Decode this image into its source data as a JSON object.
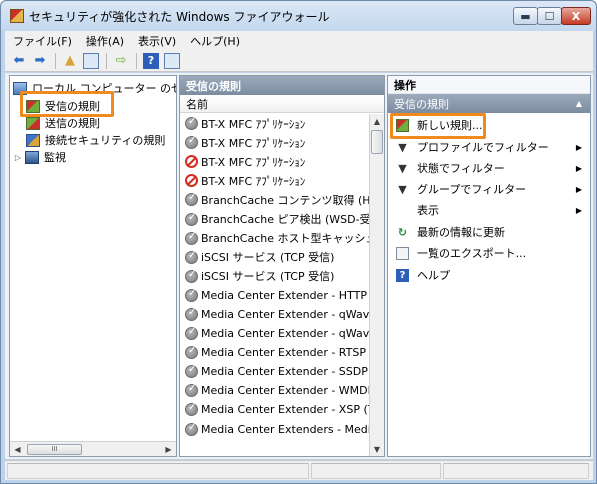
{
  "window": {
    "title": "セキュリティが強化された Windows ファイアウォール",
    "minimize": "▬",
    "maximize": "☐",
    "close": "X"
  },
  "menu": [
    "ファイル(F)",
    "操作(A)",
    "表示(V)",
    "ヘルプ(H)"
  ],
  "tree": {
    "root": "ローカル コンピューター のセ",
    "items": [
      "受信の規則",
      "送信の規則",
      "接続セキュリティの規則",
      "監視"
    ]
  },
  "middle": {
    "header": "受信の規則",
    "column": "名前",
    "rules": [
      {
        "name": "BT-X MFC ｱﾌﾟﾘｹｰｼｮﾝ",
        "status": "allow"
      },
      {
        "name": "BT-X MFC ｱﾌﾟﾘｹｰｼｮﾝ",
        "status": "allow"
      },
      {
        "name": "BT-X MFC ｱﾌﾟﾘｹｰｼｮﾝ",
        "status": "block"
      },
      {
        "name": "BT-X MFC ｱﾌﾟﾘｹｰｼｮﾝ",
        "status": "block"
      },
      {
        "name": "BranchCache コンテンツ取得 (HTT",
        "status": "allow"
      },
      {
        "name": "BranchCache ピア検出 (WSD-受信",
        "status": "allow"
      },
      {
        "name": "BranchCache ホスト型キャッシュ",
        "status": "allow"
      },
      {
        "name": "iSCSI サービス (TCP 受信)",
        "status": "allow"
      },
      {
        "name": "iSCSI サービス (TCP 受信)",
        "status": "allow"
      },
      {
        "name": "Media Center Extender - HTTP ス",
        "status": "allow"
      },
      {
        "name": "Media Center Extender - qWave (",
        "status": "allow"
      },
      {
        "name": "Media Center Extender - qWave (",
        "status": "allow"
      },
      {
        "name": "Media Center Extender - RTSP (T",
        "status": "allow"
      },
      {
        "name": "Media Center Extender - SSDP (U",
        "status": "allow"
      },
      {
        "name": "Media Center Extender - WMDRM",
        "status": "allow"
      },
      {
        "name": "Media Center Extender - XSP (TC",
        "status": "allow"
      },
      {
        "name": "Media Center Extenders - Media",
        "status": "allow"
      }
    ]
  },
  "actions": {
    "title": "操作",
    "section": "受信の規則",
    "items": [
      {
        "label": "新しい規則...",
        "icon": "new-rule-icon",
        "submenu": false
      },
      {
        "label": "プロファイルでフィルター",
        "icon": "filter-icon",
        "submenu": true
      },
      {
        "label": "状態でフィルター",
        "icon": "filter-icon",
        "submenu": true
      },
      {
        "label": "グループでフィルター",
        "icon": "filter-icon",
        "submenu": true
      },
      {
        "label": "表示",
        "icon": "",
        "submenu": true
      },
      {
        "label": "最新の情報に更新",
        "icon": "refresh-icon",
        "submenu": false
      },
      {
        "label": "一覧のエクスポート...",
        "icon": "export-icon",
        "submenu": false
      },
      {
        "label": "ヘルプ",
        "icon": "help-icon",
        "submenu": false
      }
    ]
  },
  "colors": {
    "highlight": "#f08a1c",
    "pane_header": "#8a99ad",
    "block": "#d32b1e"
  }
}
